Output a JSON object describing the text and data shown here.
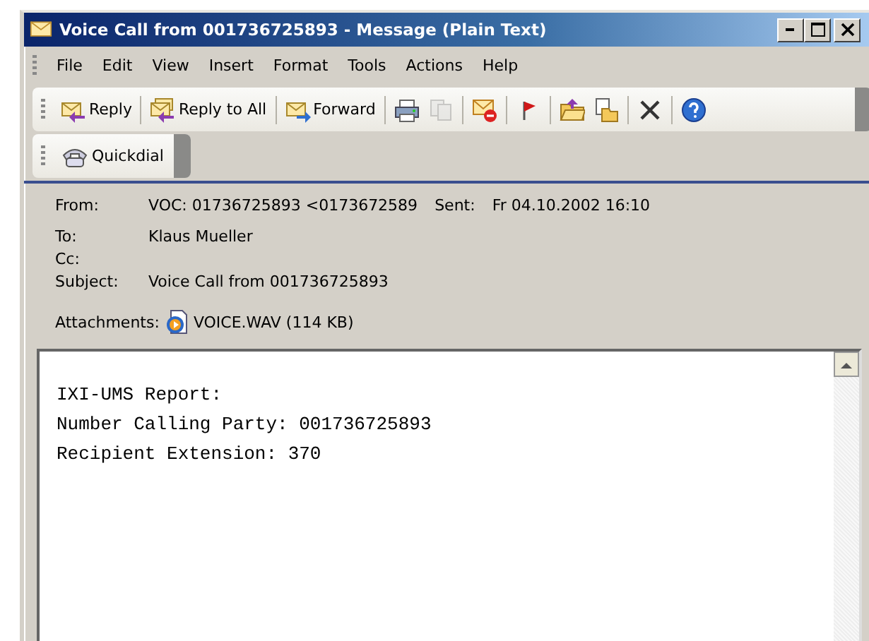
{
  "window": {
    "title": "Voice Call from 001736725893 - Message (Plain Text)"
  },
  "menu": [
    "File",
    "Edit",
    "View",
    "Insert",
    "Format",
    "Tools",
    "Actions",
    "Help"
  ],
  "toolbar": [
    {
      "kind": "labeled",
      "label": "Reply",
      "disabled": false
    },
    {
      "kind": "labeled",
      "label": "Reply to All",
      "disabled": false
    },
    {
      "kind": "labeled",
      "label": "Forward",
      "disabled": false
    },
    {
      "kind": "icon",
      "disabled": false
    },
    {
      "kind": "icon",
      "disabled": true
    },
    {
      "kind": "icon",
      "disabled": false
    },
    {
      "kind": "icon",
      "disabled": false
    },
    {
      "kind": "icon",
      "disabled": false
    },
    {
      "kind": "icon",
      "disabled": false
    },
    {
      "kind": "icon",
      "disabled": false
    },
    {
      "kind": "icon",
      "disabled": false
    }
  ],
  "quickdial": {
    "label": "Quickdial"
  },
  "header": {
    "from": {
      "label": "From:",
      "value": "VOC: 01736725893 <0173672589"
    },
    "sent": {
      "label": "Sent:",
      "value": "Fr 04.10.2002 16:10"
    },
    "to": {
      "label": "To:",
      "value": "Klaus Mueller"
    },
    "cc": {
      "label": "Cc:"
    },
    "subject": {
      "label": "Subject:",
      "value": "Voice Call from 001736725893"
    },
    "attachments": {
      "label": "Attachments:",
      "file": "VOICE.WAV (114 KB)"
    }
  },
  "body": [
    "IXI-UMS Report:",
    "Number Calling Party: 001736725893",
    "Recipient Extension: 370"
  ]
}
